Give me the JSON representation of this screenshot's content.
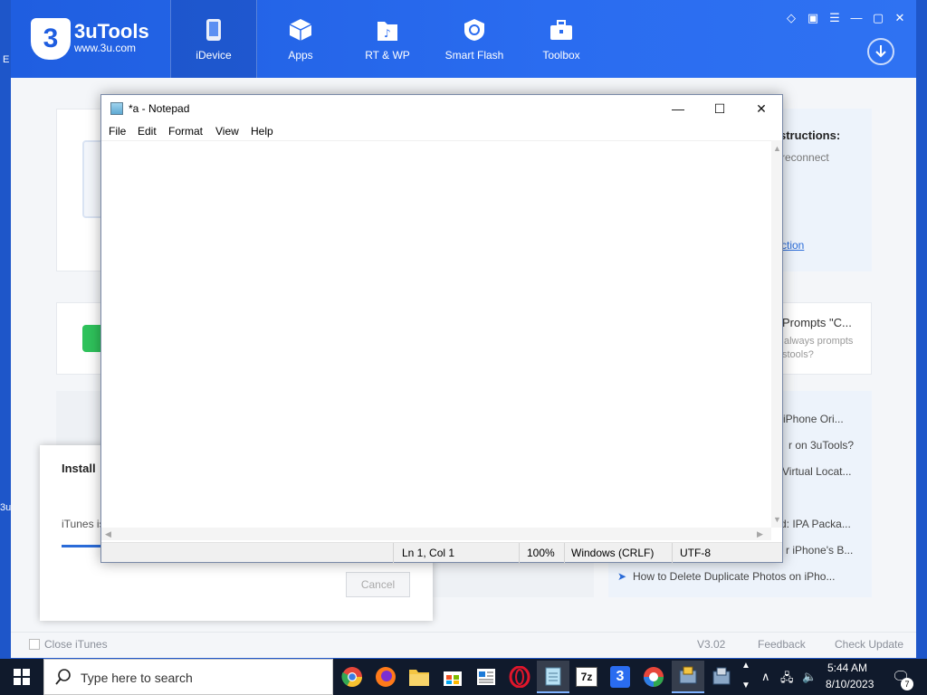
{
  "desktop": {
    "frag_left_top": "E",
    "frag_left_mid": "3u"
  },
  "tools": {
    "logo": {
      "mark": "3",
      "title": "3uTools",
      "url": "www.3u.com"
    },
    "nav": [
      {
        "label": "iDevice"
      },
      {
        "label": "Apps"
      },
      {
        "label": "RT & WP"
      },
      {
        "label": "Smart Flash"
      },
      {
        "label": "Toolbox"
      }
    ],
    "instructions": {
      "title": "structions:",
      "line1": "reconnect",
      "link": "ction"
    },
    "prompt_card": {
      "title": "Prompts \"C...",
      "line1": "always prompts",
      "line2": "stools?"
    },
    "articles": [
      "e iPhone Ori...",
      "r on 3uTools?",
      "Virtual Locat...",
      "d: IPA Packa...",
      "r iPhone's B...",
      "How to Delete Duplicate Photos on iPho..."
    ],
    "footer": {
      "close_itunes": "Close iTunes",
      "version": "V3.02",
      "feedback": "Feedback",
      "check_update": "Check Update"
    }
  },
  "install_dialog": {
    "title": "Install",
    "message": "iTunes is",
    "cancel": "Cancel"
  },
  "notepad": {
    "title": "*a - Notepad",
    "menu": [
      "File",
      "Edit",
      "Format",
      "View",
      "Help"
    ],
    "content": "",
    "status": {
      "position": "Ln 1, Col 1",
      "zoom": "100%",
      "line_ending": "Windows (CRLF)",
      "encoding": "UTF-8"
    }
  },
  "taskbar": {
    "search_placeholder": "Type here to search",
    "app_7z_label": "7z",
    "app_3u_label": "3",
    "time": "5:44 AM",
    "date": "8/10/2023",
    "notification_count": "7"
  },
  "colors": {
    "brand_blue": "#1f5ee0",
    "taskbar": "#101a2c",
    "link_blue": "#2a6bd8"
  }
}
